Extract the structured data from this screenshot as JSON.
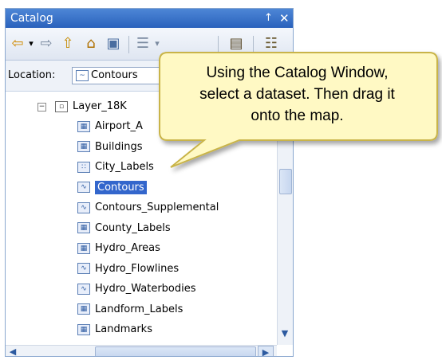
{
  "window": {
    "title": "Catalog",
    "pin_glyph": "↑",
    "close_glyph": "✕"
  },
  "toolbar": {
    "back_glyph": "⇦",
    "back_dropdown_glyph": "▾",
    "forward_glyph": "⇨",
    "up_glyph": "⇧",
    "home_glyph": "⌂",
    "toggle_glyph": "▣",
    "view_glyph": "☰",
    "view_dropdown_glyph": "▾",
    "connect_glyph": "▤",
    "options_glyph": "☷"
  },
  "location": {
    "label": "Location:",
    "value": "Contours"
  },
  "tree": {
    "root": {
      "label": "Layer_18K",
      "expander": "−",
      "icon": "layer-group-icon"
    },
    "items": [
      {
        "label": "Airport_A",
        "icon": "polygon-icon",
        "glyph": "▦"
      },
      {
        "label": "Buildings",
        "icon": "polygon-icon",
        "glyph": "▦"
      },
      {
        "label": "City_Labels",
        "icon": "point-icon",
        "glyph": "∷"
      },
      {
        "label": "Contours",
        "icon": "line-icon",
        "glyph": "∿",
        "selected": true
      },
      {
        "label": "Contours_Supplemental",
        "icon": "line-icon",
        "glyph": "∿"
      },
      {
        "label": "County_Labels",
        "icon": "polygon-icon",
        "glyph": "▦"
      },
      {
        "label": "Hydro_Areas",
        "icon": "polygon-icon",
        "glyph": "▦"
      },
      {
        "label": "Hydro_Flowlines",
        "icon": "line-icon",
        "glyph": "∿"
      },
      {
        "label": "Hydro_Waterbodies",
        "icon": "line-icon",
        "glyph": "∿"
      },
      {
        "label": "Landform_Labels",
        "icon": "polygon-icon",
        "glyph": "▦"
      },
      {
        "label": "Landmarks",
        "icon": "polygon-icon",
        "glyph": "▦"
      }
    ]
  },
  "scroll": {
    "down_glyph": "▼",
    "left_glyph": "◀",
    "right_glyph": "▶"
  },
  "callout": {
    "line1": "Using the Catalog Window,",
    "line2": "select a dataset. Then drag it",
    "line3": "onto the map."
  },
  "colors": {
    "titlebar": "#2a62bc",
    "selection": "#3366cc",
    "callout_fill": "#fff9c4",
    "callout_border": "#c9b44a"
  }
}
